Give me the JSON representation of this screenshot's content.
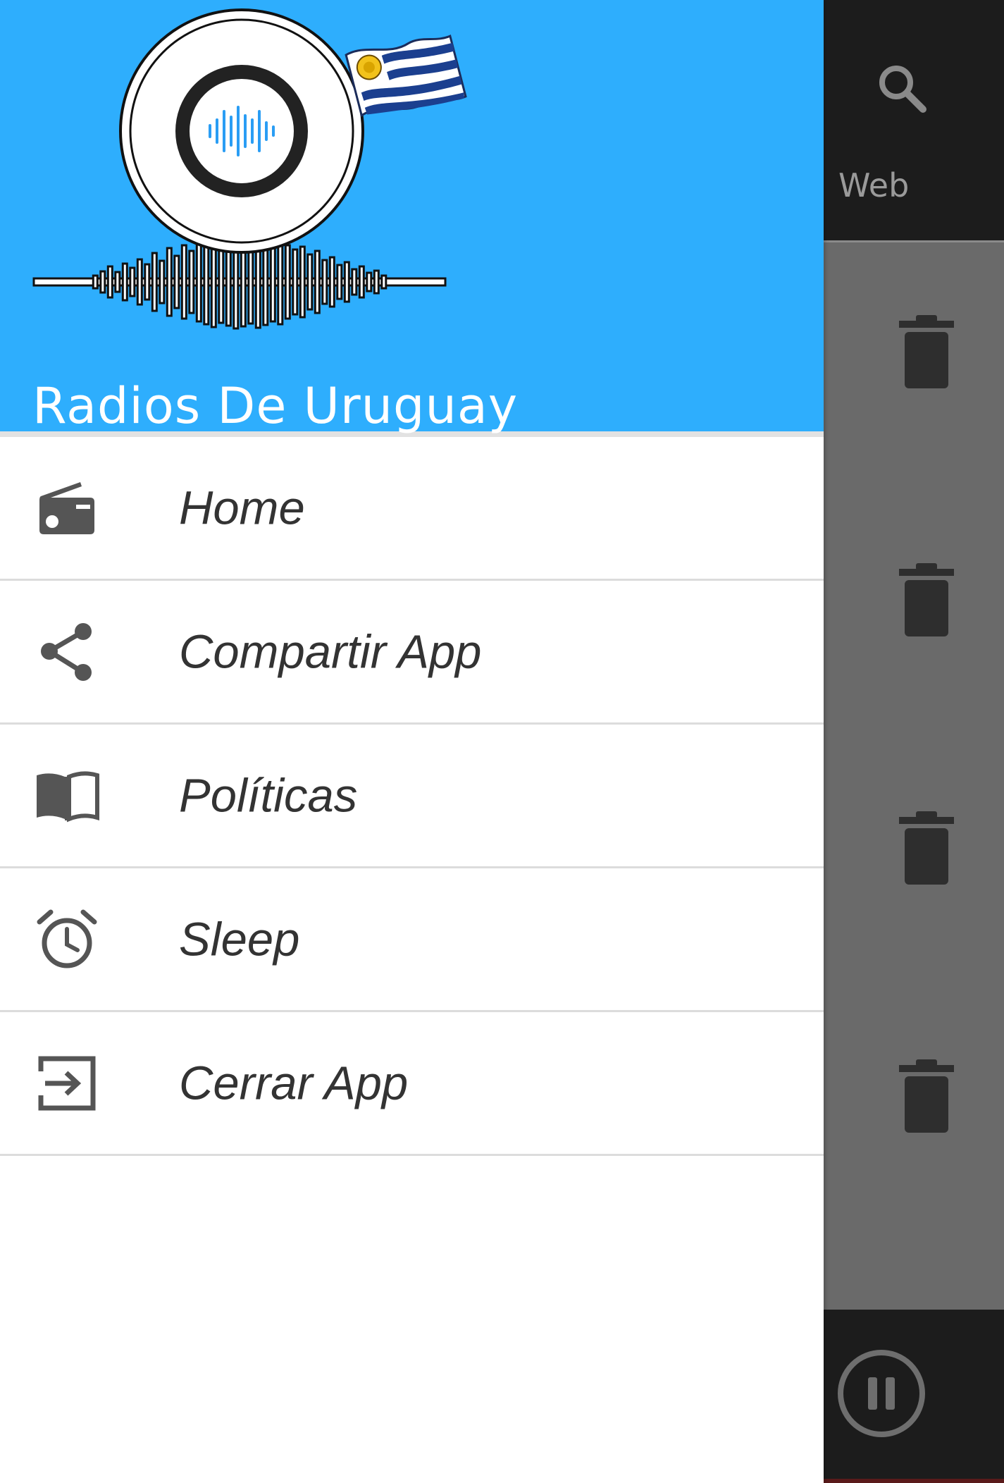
{
  "app": {
    "title": "Radios De Uruguay"
  },
  "colors": {
    "header_bg": "#2eaefd",
    "drawer_bg": "#ffffff",
    "menu_text": "#333333",
    "icon": "#555555",
    "toolbar_bg": "#1c1c1c",
    "list_scrim": "#6a6a6a"
  },
  "drawer": {
    "items": [
      {
        "label": "Home",
        "icon": "radio-icon"
      },
      {
        "label": "Compartir App",
        "icon": "share-icon"
      },
      {
        "label": "Políticas",
        "icon": "book-icon"
      },
      {
        "label": "Sleep",
        "icon": "alarm-clock-icon"
      },
      {
        "label": "Cerrar App",
        "icon": "exit-icon"
      }
    ]
  },
  "background_screen": {
    "toolbar": {
      "search_icon": "search-icon",
      "tab_label": "Web"
    },
    "list": {
      "row_icon": "trash-icon",
      "row_count": 4
    },
    "player": {
      "control_icon": "pause-icon"
    }
  }
}
